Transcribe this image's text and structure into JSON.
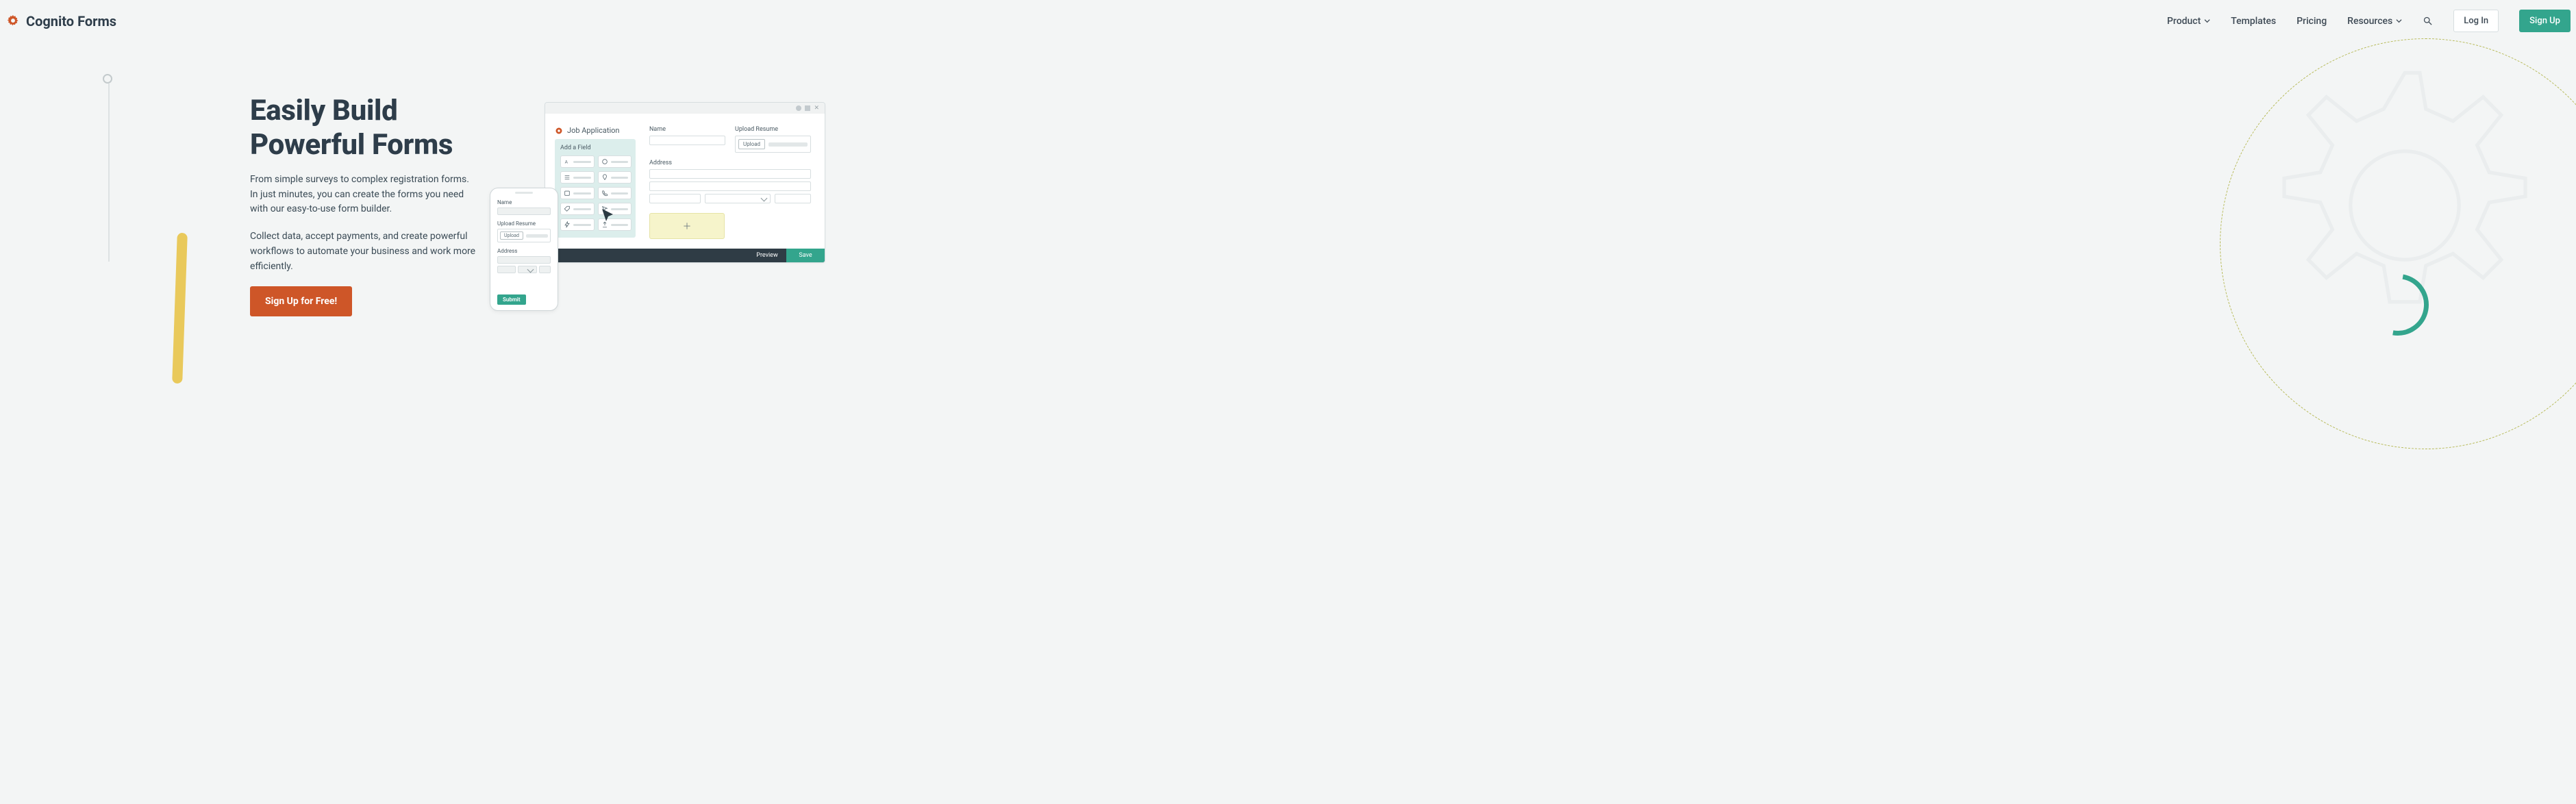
{
  "brand": {
    "name": "Cognito Forms"
  },
  "nav": {
    "product": "Product",
    "templates": "Templates",
    "pricing": "Pricing",
    "resources": "Resources",
    "login": "Log In",
    "signup": "Sign Up"
  },
  "hero": {
    "headline": "Easily Build Powerful Forms",
    "para1": "From simple surveys to complex registration forms. In just minutes, you can create the forms you need with our easy-to-use form builder.",
    "para2": "Collect data, accept payments, and create powerful workflows to automate your business and work more efficiently.",
    "cta": "Sign Up for Free!"
  },
  "builder": {
    "form_title": "Job Application",
    "palette_title": "Add a Field",
    "labels": {
      "name": "Name",
      "upload_resume": "Upload Resume",
      "upload_btn": "Upload",
      "address": "Address"
    },
    "footer": {
      "preview": "Preview",
      "save": "Save"
    }
  },
  "phone": {
    "labels": {
      "name": "Name",
      "upload_resume": "Upload Resume",
      "upload_btn": "Upload",
      "address": "Address",
      "submit": "Submit"
    }
  },
  "colors": {
    "accent_orange": "#CE5628",
    "accent_teal": "#33A58D",
    "page_bg": "#F3F5F5"
  }
}
